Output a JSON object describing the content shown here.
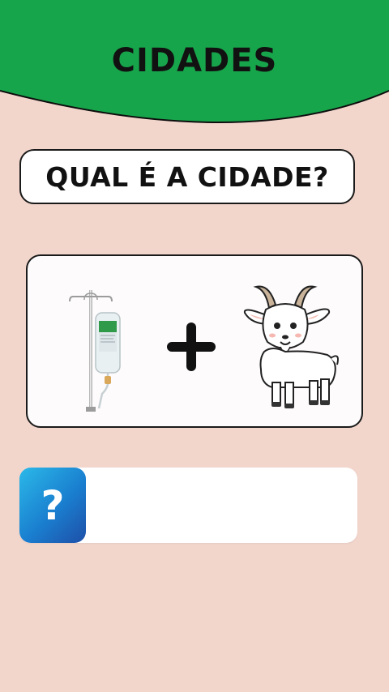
{
  "header": {
    "title": "CIDADES",
    "bg_color": "#17a54b"
  },
  "question": {
    "text": "QUAL É A CIDADE?"
  },
  "puzzle": {
    "left_icon": "iv-drip-icon",
    "operator": "plus-icon",
    "right_icon": "goat-icon"
  },
  "answer": {
    "icon_text": "?",
    "value": ""
  }
}
